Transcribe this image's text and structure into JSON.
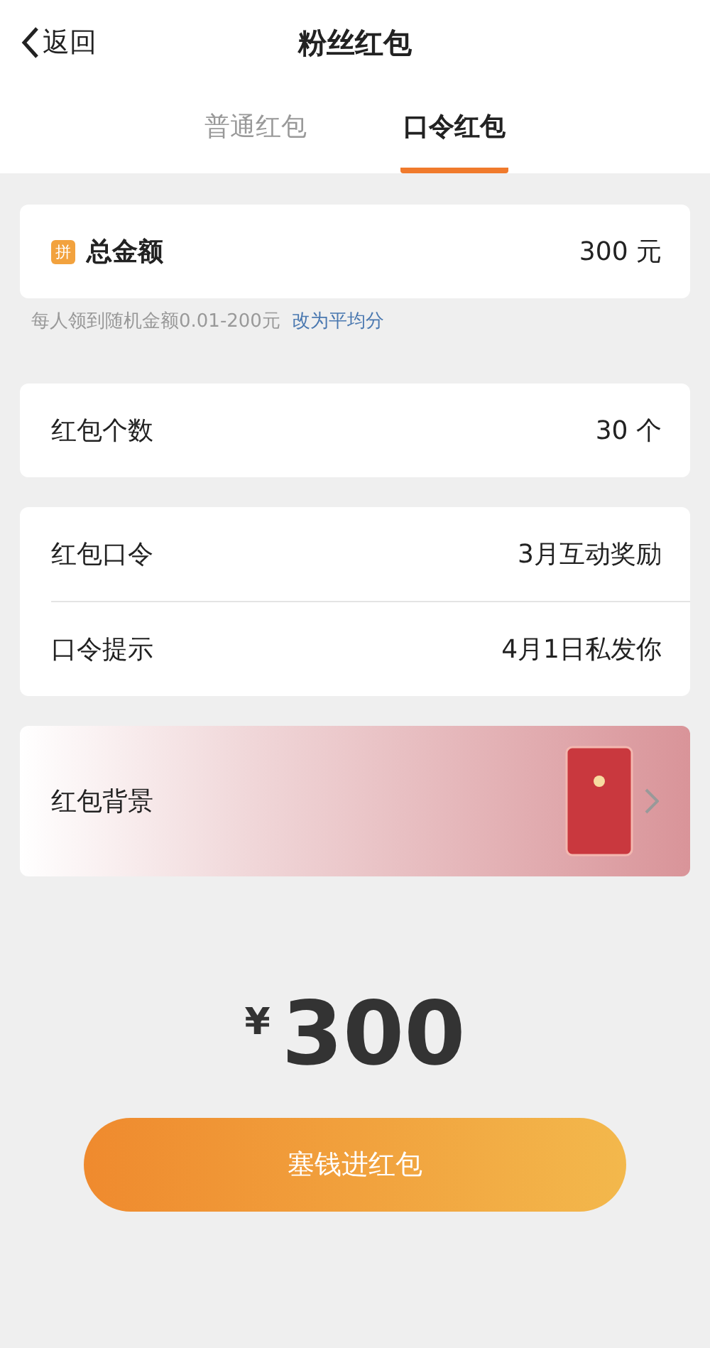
{
  "nav": {
    "back": "返回",
    "title": "粉丝红包"
  },
  "tabs": [
    {
      "label": "普通红包",
      "selected": false
    },
    {
      "label": "口令红包",
      "selected": true
    }
  ],
  "total": {
    "badge": "拼",
    "label": "总金额",
    "value": "300 元"
  },
  "note": {
    "text": "每人领到随机金额0.01-200元",
    "link": "改为平均分"
  },
  "count": {
    "label": "红包个数",
    "value": "30 个"
  },
  "password": [
    {
      "label": "红包口令",
      "value": "3月互动奖励"
    },
    {
      "label": "口令提示",
      "value": "4月1日私发你"
    }
  ],
  "background": {
    "label": "红包背景"
  },
  "amount": {
    "currency": "¥",
    "value": "300"
  },
  "submit": "塞钱进红包"
}
